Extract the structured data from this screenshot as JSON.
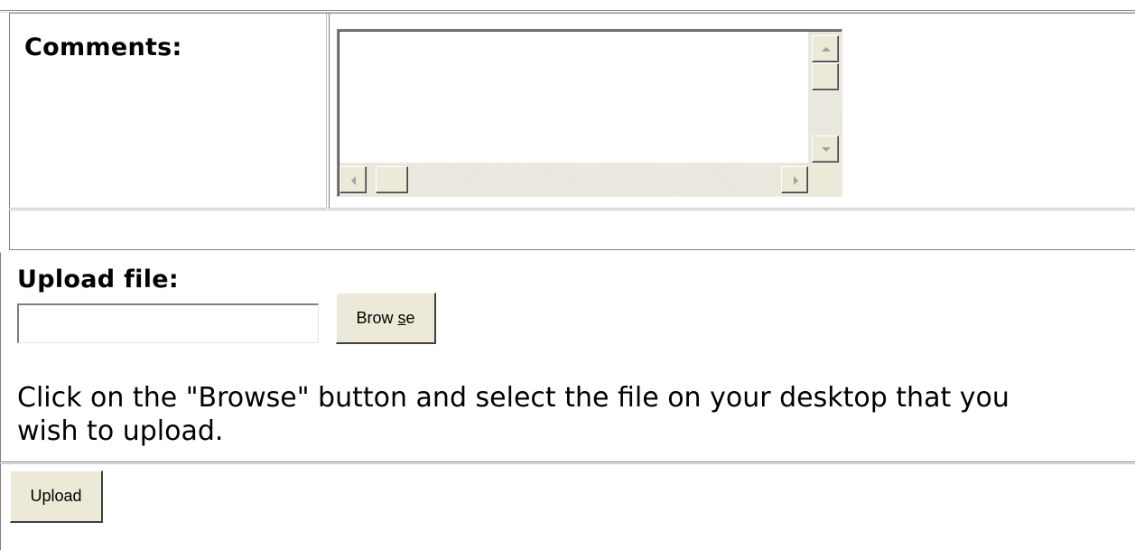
{
  "comments": {
    "label": "Comments:",
    "value": ""
  },
  "upload": {
    "label": "Upload file:",
    "file_value": "",
    "browse_label": "Browse",
    "browse_access_key": "s",
    "help_text": "Click on the \"Browse\" button and select the file on your desktop that you wish to upload."
  },
  "submit": {
    "upload_label": "Upload"
  },
  "colors": {
    "button_face": "#ece9d8",
    "border_dark": "#808080"
  }
}
